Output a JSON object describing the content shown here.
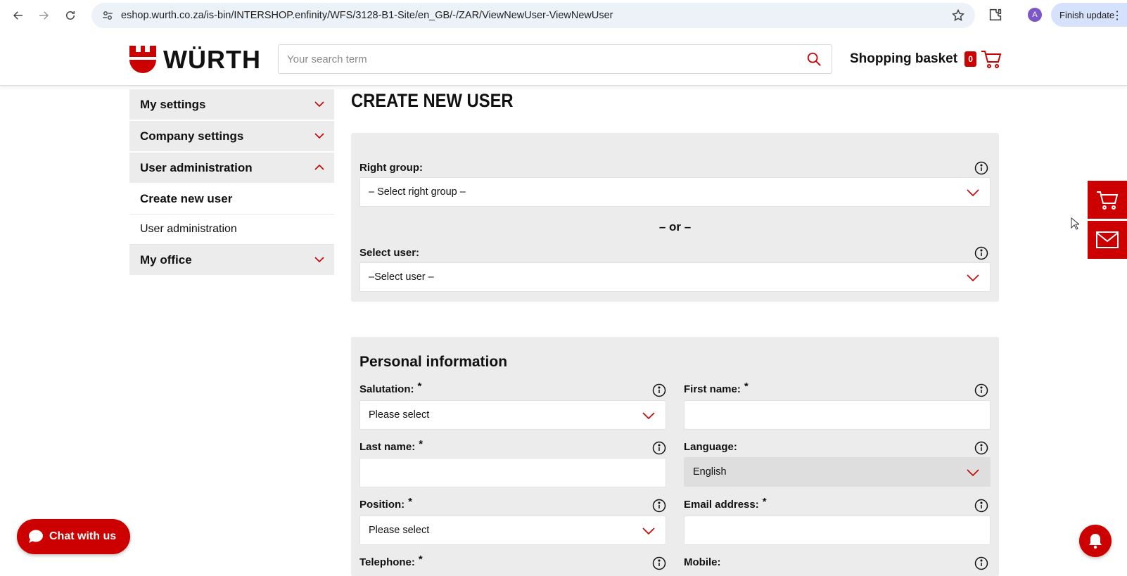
{
  "browser": {
    "url": "eshop.wurth.co.za/is-bin/INTERSHOP.enfinity/WFS/3128-B1-Site/en_GB/-/ZAR/ViewNewUser-ViewNewUser",
    "avatar_letter": "A",
    "finish_update_label": "Finish update"
  },
  "header": {
    "logo_text": "WÜRTH",
    "search_placeholder": "Your search term",
    "basket_label": "Shopping basket",
    "basket_count": "0"
  },
  "sidebar": {
    "groups": [
      {
        "label": "My settings"
      },
      {
        "label": "Company settings"
      },
      {
        "label": "User administration"
      }
    ],
    "sub_items": [
      {
        "label": "Create new user"
      },
      {
        "label": "User administration"
      }
    ],
    "last_group": {
      "label": "My office"
    }
  },
  "main": {
    "title": "CREATE NEW USER",
    "right_group": {
      "label": "Right group:",
      "value": "– Select right group –"
    },
    "or_text": "– or –",
    "select_user": {
      "label": "Select user:",
      "value": "–Select user –"
    },
    "personal": {
      "title": "Personal information",
      "salutation": {
        "label": "Salutation:",
        "value": "Please select"
      },
      "first_name": {
        "label": "First name:"
      },
      "last_name": {
        "label": "Last name:"
      },
      "language": {
        "label": "Language:",
        "value": "English"
      },
      "position": {
        "label": "Position:",
        "value": "Please select"
      },
      "email": {
        "label": "Email address:"
      },
      "telephone": {
        "label": "Telephone:"
      },
      "mobile": {
        "label": "Mobile:"
      },
      "required_mark": "*"
    }
  },
  "floating": {
    "chat_label": "Chat with us"
  },
  "colors": {
    "brand_red": "#cc0000",
    "panel_grey": "#ececec"
  }
}
